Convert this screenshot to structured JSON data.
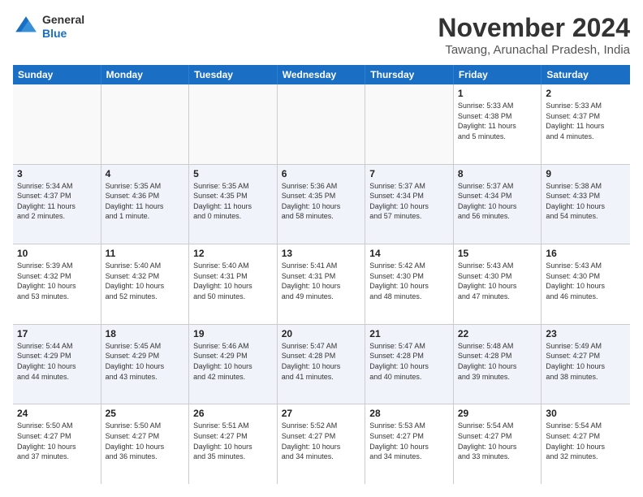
{
  "logo": {
    "general": "General",
    "blue": "Blue"
  },
  "title": "November 2024",
  "location": "Tawang, Arunachal Pradesh, India",
  "days_of_week": [
    "Sunday",
    "Monday",
    "Tuesday",
    "Wednesday",
    "Thursday",
    "Friday",
    "Saturday"
  ],
  "weeks": [
    {
      "alt": false,
      "days": [
        {
          "num": "",
          "empty": true,
          "info": ""
        },
        {
          "num": "",
          "empty": true,
          "info": ""
        },
        {
          "num": "",
          "empty": true,
          "info": ""
        },
        {
          "num": "",
          "empty": true,
          "info": ""
        },
        {
          "num": "",
          "empty": true,
          "info": ""
        },
        {
          "num": "1",
          "empty": false,
          "info": "Sunrise: 5:33 AM\nSunset: 4:38 PM\nDaylight: 11 hours\nand 5 minutes."
        },
        {
          "num": "2",
          "empty": false,
          "info": "Sunrise: 5:33 AM\nSunset: 4:37 PM\nDaylight: 11 hours\nand 4 minutes."
        }
      ]
    },
    {
      "alt": true,
      "days": [
        {
          "num": "3",
          "empty": false,
          "info": "Sunrise: 5:34 AM\nSunset: 4:37 PM\nDaylight: 11 hours\nand 2 minutes."
        },
        {
          "num": "4",
          "empty": false,
          "info": "Sunrise: 5:35 AM\nSunset: 4:36 PM\nDaylight: 11 hours\nand 1 minute."
        },
        {
          "num": "5",
          "empty": false,
          "info": "Sunrise: 5:35 AM\nSunset: 4:35 PM\nDaylight: 11 hours\nand 0 minutes."
        },
        {
          "num": "6",
          "empty": false,
          "info": "Sunrise: 5:36 AM\nSunset: 4:35 PM\nDaylight: 10 hours\nand 58 minutes."
        },
        {
          "num": "7",
          "empty": false,
          "info": "Sunrise: 5:37 AM\nSunset: 4:34 PM\nDaylight: 10 hours\nand 57 minutes."
        },
        {
          "num": "8",
          "empty": false,
          "info": "Sunrise: 5:37 AM\nSunset: 4:34 PM\nDaylight: 10 hours\nand 56 minutes."
        },
        {
          "num": "9",
          "empty": false,
          "info": "Sunrise: 5:38 AM\nSunset: 4:33 PM\nDaylight: 10 hours\nand 54 minutes."
        }
      ]
    },
    {
      "alt": false,
      "days": [
        {
          "num": "10",
          "empty": false,
          "info": "Sunrise: 5:39 AM\nSunset: 4:32 PM\nDaylight: 10 hours\nand 53 minutes."
        },
        {
          "num": "11",
          "empty": false,
          "info": "Sunrise: 5:40 AM\nSunset: 4:32 PM\nDaylight: 10 hours\nand 52 minutes."
        },
        {
          "num": "12",
          "empty": false,
          "info": "Sunrise: 5:40 AM\nSunset: 4:31 PM\nDaylight: 10 hours\nand 50 minutes."
        },
        {
          "num": "13",
          "empty": false,
          "info": "Sunrise: 5:41 AM\nSunset: 4:31 PM\nDaylight: 10 hours\nand 49 minutes."
        },
        {
          "num": "14",
          "empty": false,
          "info": "Sunrise: 5:42 AM\nSunset: 4:30 PM\nDaylight: 10 hours\nand 48 minutes."
        },
        {
          "num": "15",
          "empty": false,
          "info": "Sunrise: 5:43 AM\nSunset: 4:30 PM\nDaylight: 10 hours\nand 47 minutes."
        },
        {
          "num": "16",
          "empty": false,
          "info": "Sunrise: 5:43 AM\nSunset: 4:30 PM\nDaylight: 10 hours\nand 46 minutes."
        }
      ]
    },
    {
      "alt": true,
      "days": [
        {
          "num": "17",
          "empty": false,
          "info": "Sunrise: 5:44 AM\nSunset: 4:29 PM\nDaylight: 10 hours\nand 44 minutes."
        },
        {
          "num": "18",
          "empty": false,
          "info": "Sunrise: 5:45 AM\nSunset: 4:29 PM\nDaylight: 10 hours\nand 43 minutes."
        },
        {
          "num": "19",
          "empty": false,
          "info": "Sunrise: 5:46 AM\nSunset: 4:29 PM\nDaylight: 10 hours\nand 42 minutes."
        },
        {
          "num": "20",
          "empty": false,
          "info": "Sunrise: 5:47 AM\nSunset: 4:28 PM\nDaylight: 10 hours\nand 41 minutes."
        },
        {
          "num": "21",
          "empty": false,
          "info": "Sunrise: 5:47 AM\nSunset: 4:28 PM\nDaylight: 10 hours\nand 40 minutes."
        },
        {
          "num": "22",
          "empty": false,
          "info": "Sunrise: 5:48 AM\nSunset: 4:28 PM\nDaylight: 10 hours\nand 39 minutes."
        },
        {
          "num": "23",
          "empty": false,
          "info": "Sunrise: 5:49 AM\nSunset: 4:27 PM\nDaylight: 10 hours\nand 38 minutes."
        }
      ]
    },
    {
      "alt": false,
      "days": [
        {
          "num": "24",
          "empty": false,
          "info": "Sunrise: 5:50 AM\nSunset: 4:27 PM\nDaylight: 10 hours\nand 37 minutes."
        },
        {
          "num": "25",
          "empty": false,
          "info": "Sunrise: 5:50 AM\nSunset: 4:27 PM\nDaylight: 10 hours\nand 36 minutes."
        },
        {
          "num": "26",
          "empty": false,
          "info": "Sunrise: 5:51 AM\nSunset: 4:27 PM\nDaylight: 10 hours\nand 35 minutes."
        },
        {
          "num": "27",
          "empty": false,
          "info": "Sunrise: 5:52 AM\nSunset: 4:27 PM\nDaylight: 10 hours\nand 34 minutes."
        },
        {
          "num": "28",
          "empty": false,
          "info": "Sunrise: 5:53 AM\nSunset: 4:27 PM\nDaylight: 10 hours\nand 34 minutes."
        },
        {
          "num": "29",
          "empty": false,
          "info": "Sunrise: 5:54 AM\nSunset: 4:27 PM\nDaylight: 10 hours\nand 33 minutes."
        },
        {
          "num": "30",
          "empty": false,
          "info": "Sunrise: 5:54 AM\nSunset: 4:27 PM\nDaylight: 10 hours\nand 32 minutes."
        }
      ]
    }
  ]
}
